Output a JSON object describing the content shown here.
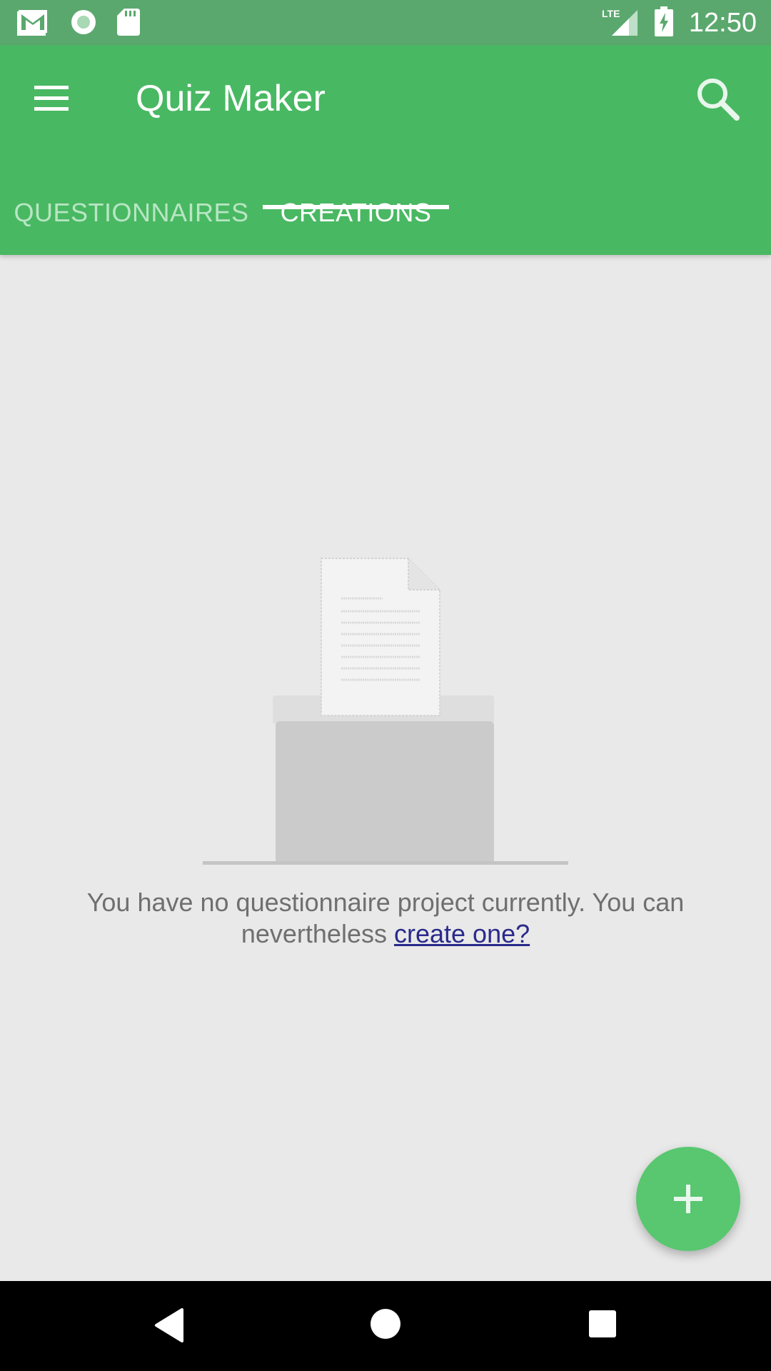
{
  "status_bar": {
    "time": "12:50",
    "network": "LTE",
    "left_icons": [
      "gmail-icon",
      "circle-notification-icon",
      "sd-card-icon"
    ],
    "right_icons": [
      "signal-icon",
      "battery-charging-icon"
    ]
  },
  "app_bar": {
    "title": "Quiz Maker",
    "menu_icon": "hamburger-menu-icon",
    "search_icon": "search-icon"
  },
  "tabs": [
    {
      "label": "QUESTIONNAIRES",
      "selected": false
    },
    {
      "label": "CREATIONS",
      "selected": true
    }
  ],
  "empty_state": {
    "message": "You have no questionnaire project currently. You can nevertheless",
    "link_text": "create one?",
    "illustration_icon": "ballot-box-icon"
  },
  "fab": {
    "icon": "plus-icon"
  },
  "nav_bar": {
    "icons": [
      "back-icon",
      "home-icon",
      "recents-icon"
    ]
  },
  "colors": {
    "status_bar": "#5ba86e",
    "app_bar": "#49b862",
    "fab": "#58c76f",
    "background": "#e9e9e9",
    "link": "#2a2a8c"
  }
}
